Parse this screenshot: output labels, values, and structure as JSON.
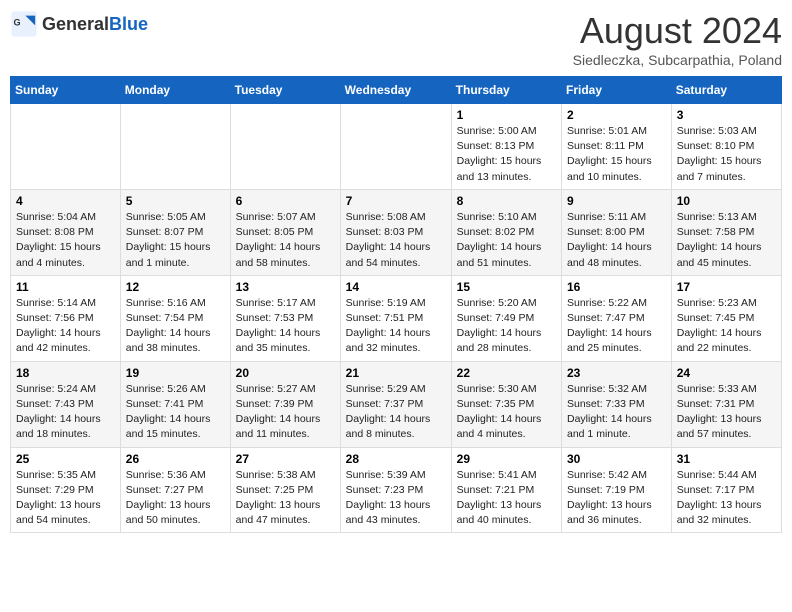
{
  "header": {
    "logo_general": "General",
    "logo_blue": "Blue",
    "month_title": "August 2024",
    "location": "Siedleczka, Subcarpathia, Poland"
  },
  "days_of_week": [
    "Sunday",
    "Monday",
    "Tuesday",
    "Wednesday",
    "Thursday",
    "Friday",
    "Saturday"
  ],
  "weeks": [
    [
      {
        "day": "",
        "info": ""
      },
      {
        "day": "",
        "info": ""
      },
      {
        "day": "",
        "info": ""
      },
      {
        "day": "",
        "info": ""
      },
      {
        "day": "1",
        "info": "Sunrise: 5:00 AM\nSunset: 8:13 PM\nDaylight: 15 hours\nand 13 minutes."
      },
      {
        "day": "2",
        "info": "Sunrise: 5:01 AM\nSunset: 8:11 PM\nDaylight: 15 hours\nand 10 minutes."
      },
      {
        "day": "3",
        "info": "Sunrise: 5:03 AM\nSunset: 8:10 PM\nDaylight: 15 hours\nand 7 minutes."
      }
    ],
    [
      {
        "day": "4",
        "info": "Sunrise: 5:04 AM\nSunset: 8:08 PM\nDaylight: 15 hours\nand 4 minutes."
      },
      {
        "day": "5",
        "info": "Sunrise: 5:05 AM\nSunset: 8:07 PM\nDaylight: 15 hours\nand 1 minute."
      },
      {
        "day": "6",
        "info": "Sunrise: 5:07 AM\nSunset: 8:05 PM\nDaylight: 14 hours\nand 58 minutes."
      },
      {
        "day": "7",
        "info": "Sunrise: 5:08 AM\nSunset: 8:03 PM\nDaylight: 14 hours\nand 54 minutes."
      },
      {
        "day": "8",
        "info": "Sunrise: 5:10 AM\nSunset: 8:02 PM\nDaylight: 14 hours\nand 51 minutes."
      },
      {
        "day": "9",
        "info": "Sunrise: 5:11 AM\nSunset: 8:00 PM\nDaylight: 14 hours\nand 48 minutes."
      },
      {
        "day": "10",
        "info": "Sunrise: 5:13 AM\nSunset: 7:58 PM\nDaylight: 14 hours\nand 45 minutes."
      }
    ],
    [
      {
        "day": "11",
        "info": "Sunrise: 5:14 AM\nSunset: 7:56 PM\nDaylight: 14 hours\nand 42 minutes."
      },
      {
        "day": "12",
        "info": "Sunrise: 5:16 AM\nSunset: 7:54 PM\nDaylight: 14 hours\nand 38 minutes."
      },
      {
        "day": "13",
        "info": "Sunrise: 5:17 AM\nSunset: 7:53 PM\nDaylight: 14 hours\nand 35 minutes."
      },
      {
        "day": "14",
        "info": "Sunrise: 5:19 AM\nSunset: 7:51 PM\nDaylight: 14 hours\nand 32 minutes."
      },
      {
        "day": "15",
        "info": "Sunrise: 5:20 AM\nSunset: 7:49 PM\nDaylight: 14 hours\nand 28 minutes."
      },
      {
        "day": "16",
        "info": "Sunrise: 5:22 AM\nSunset: 7:47 PM\nDaylight: 14 hours\nand 25 minutes."
      },
      {
        "day": "17",
        "info": "Sunrise: 5:23 AM\nSunset: 7:45 PM\nDaylight: 14 hours\nand 22 minutes."
      }
    ],
    [
      {
        "day": "18",
        "info": "Sunrise: 5:24 AM\nSunset: 7:43 PM\nDaylight: 14 hours\nand 18 minutes."
      },
      {
        "day": "19",
        "info": "Sunrise: 5:26 AM\nSunset: 7:41 PM\nDaylight: 14 hours\nand 15 minutes."
      },
      {
        "day": "20",
        "info": "Sunrise: 5:27 AM\nSunset: 7:39 PM\nDaylight: 14 hours\nand 11 minutes."
      },
      {
        "day": "21",
        "info": "Sunrise: 5:29 AM\nSunset: 7:37 PM\nDaylight: 14 hours\nand 8 minutes."
      },
      {
        "day": "22",
        "info": "Sunrise: 5:30 AM\nSunset: 7:35 PM\nDaylight: 14 hours\nand 4 minutes."
      },
      {
        "day": "23",
        "info": "Sunrise: 5:32 AM\nSunset: 7:33 PM\nDaylight: 14 hours\nand 1 minute."
      },
      {
        "day": "24",
        "info": "Sunrise: 5:33 AM\nSunset: 7:31 PM\nDaylight: 13 hours\nand 57 minutes."
      }
    ],
    [
      {
        "day": "25",
        "info": "Sunrise: 5:35 AM\nSunset: 7:29 PM\nDaylight: 13 hours\nand 54 minutes."
      },
      {
        "day": "26",
        "info": "Sunrise: 5:36 AM\nSunset: 7:27 PM\nDaylight: 13 hours\nand 50 minutes."
      },
      {
        "day": "27",
        "info": "Sunrise: 5:38 AM\nSunset: 7:25 PM\nDaylight: 13 hours\nand 47 minutes."
      },
      {
        "day": "28",
        "info": "Sunrise: 5:39 AM\nSunset: 7:23 PM\nDaylight: 13 hours\nand 43 minutes."
      },
      {
        "day": "29",
        "info": "Sunrise: 5:41 AM\nSunset: 7:21 PM\nDaylight: 13 hours\nand 40 minutes."
      },
      {
        "day": "30",
        "info": "Sunrise: 5:42 AM\nSunset: 7:19 PM\nDaylight: 13 hours\nand 36 minutes."
      },
      {
        "day": "31",
        "info": "Sunrise: 5:44 AM\nSunset: 7:17 PM\nDaylight: 13 hours\nand 32 minutes."
      }
    ]
  ]
}
